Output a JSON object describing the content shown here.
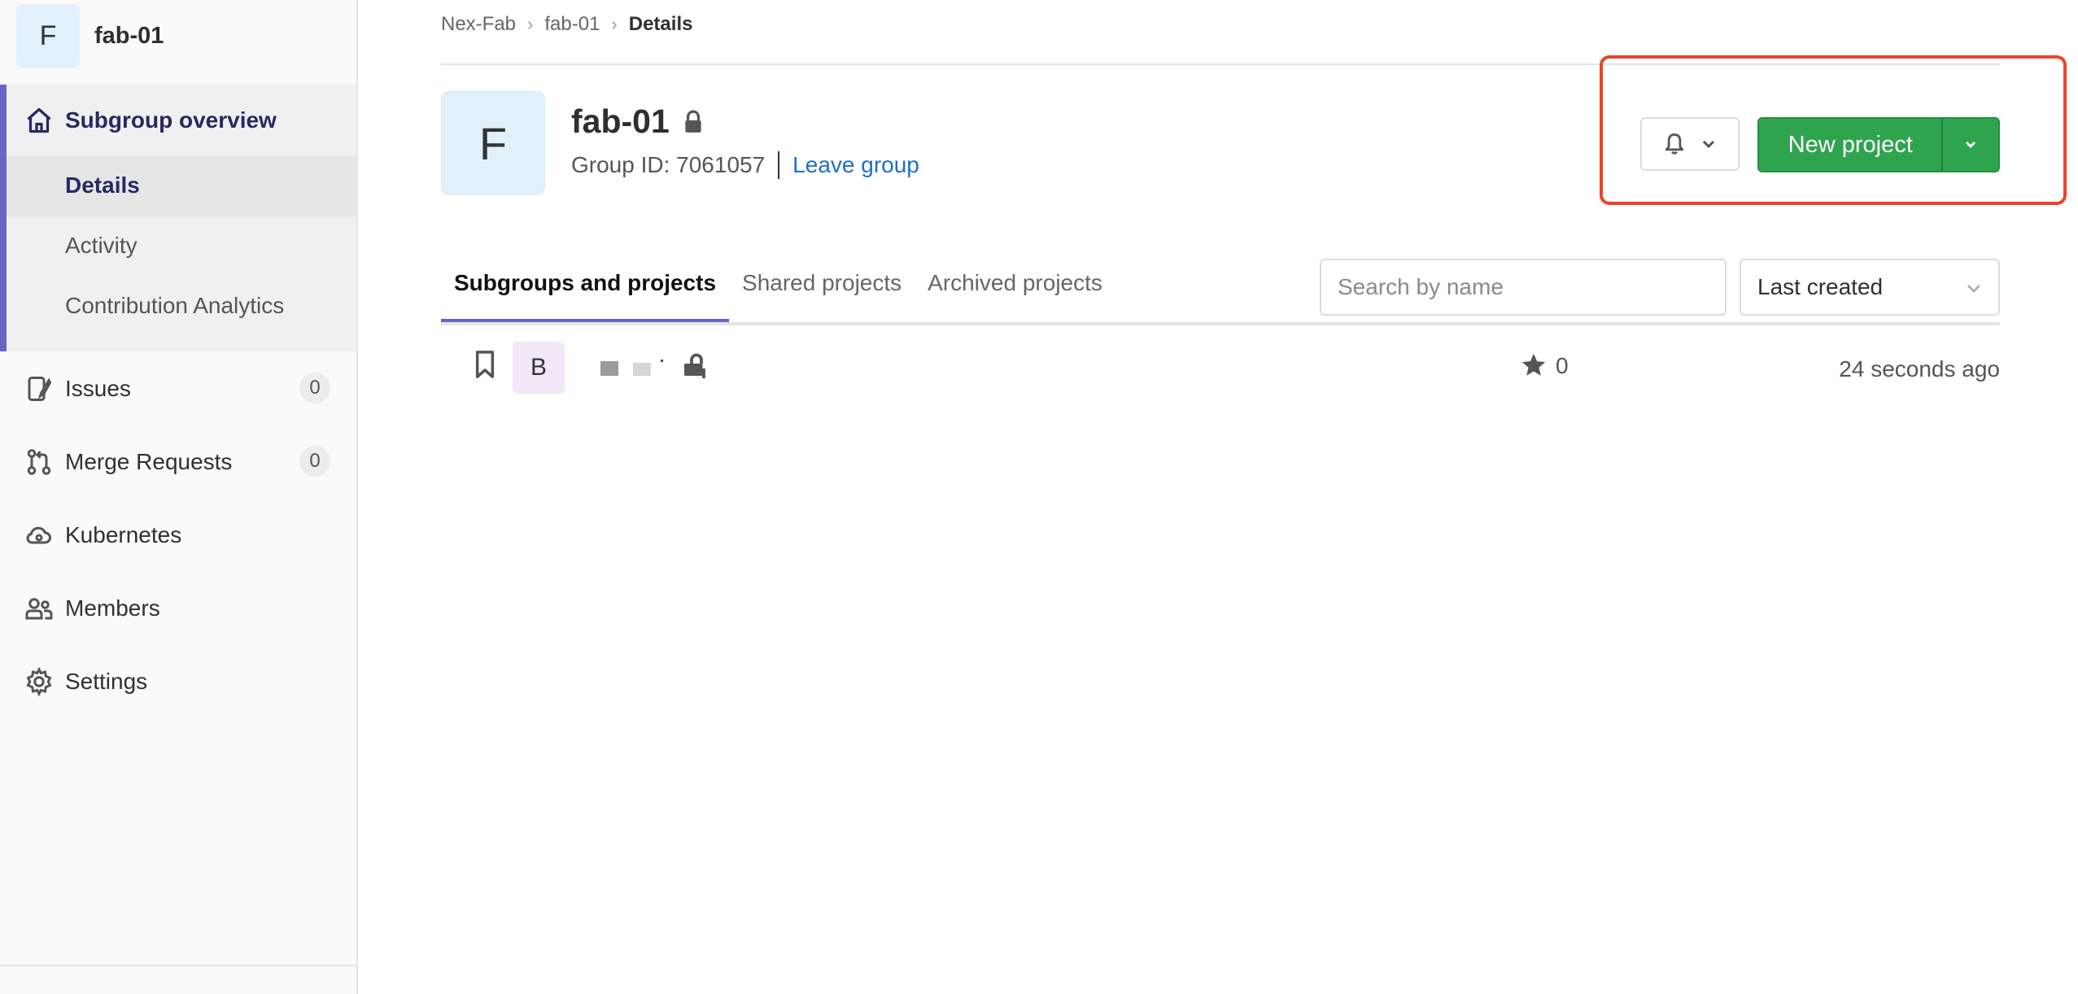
{
  "sidebar": {
    "group_avatar_letter": "F",
    "group_name": "fab-01",
    "section_title": "Subgroup overview",
    "section_items": [
      {
        "label": "Details",
        "active": true
      },
      {
        "label": "Activity",
        "active": false
      },
      {
        "label": "Contribution Analytics",
        "active": false
      }
    ],
    "items": [
      {
        "label": "Issues",
        "count": "0",
        "icon": "issues-icon"
      },
      {
        "label": "Merge Requests",
        "count": "0",
        "icon": "merge-request-icon"
      },
      {
        "label": "Kubernetes",
        "icon": "cloud-icon"
      },
      {
        "label": "Members",
        "icon": "users-icon"
      },
      {
        "label": "Settings",
        "icon": "gear-icon"
      }
    ]
  },
  "breadcrumb": [
    "Nex-Fab",
    "fab-01",
    "Details"
  ],
  "group": {
    "avatar_letter": "F",
    "name": "fab-01",
    "visibility": "private",
    "group_id_text": "Group ID: 7061057",
    "leave_link": "Leave group"
  },
  "actions": {
    "new_project_label": "New project",
    "highlight_color": "#e8452c"
  },
  "tabs": [
    {
      "label": "Subgroups and projects",
      "active": true
    },
    {
      "label": "Shared projects",
      "active": false
    },
    {
      "label": "Archived projects",
      "active": false
    }
  ],
  "search": {
    "placeholder": "Search by name",
    "value": ""
  },
  "sort": {
    "selected": "Last created"
  },
  "projects": [
    {
      "avatar_letter": "B",
      "stars": "0",
      "updated": "24 seconds ago"
    }
  ],
  "colors": {
    "accent": "#6666c4",
    "primary_button": "#2fa44f",
    "link": "#1f6fc5"
  }
}
